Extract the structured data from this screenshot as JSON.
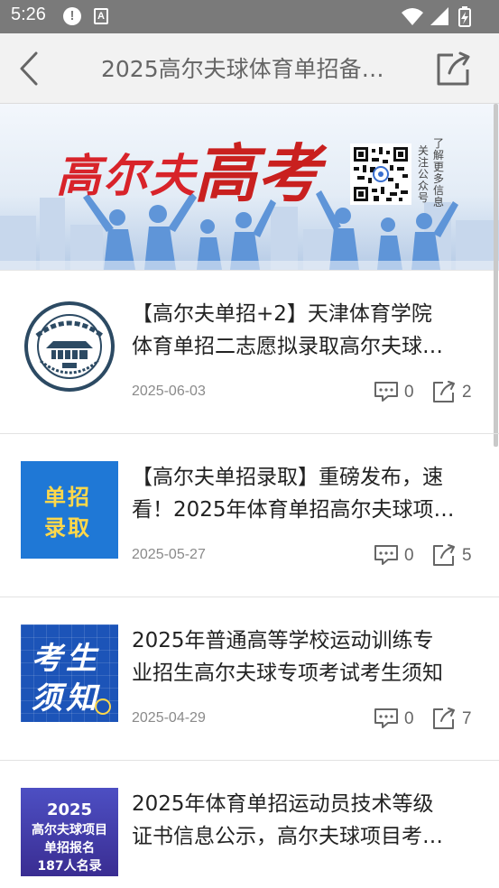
{
  "status_bar": {
    "time": "5:26",
    "alert_glyph": "!",
    "a_glyph": "A",
    "icons": [
      "alert-icon",
      "font-a-icon",
      "wifi-icon",
      "signal-icon",
      "battery-icon"
    ]
  },
  "header": {
    "title": "2025高尔夫球体育单招备…",
    "back_icon": "chevron-left-icon",
    "share_icon": "share-icon"
  },
  "banner": {
    "title_part1": "高尔夫",
    "title_part2": "高考",
    "qr_caption_col1": "关注公众号",
    "qr_caption_col2": "了解更多信息"
  },
  "articles": [
    {
      "title_line1": "【高尔夫单招+2】天津体育学院",
      "title_line2": "体育单招二志愿拟录取高尔夫球…",
      "date": "2025-06-03",
      "comments": "0",
      "shares": "2",
      "thumb": "university-seal"
    },
    {
      "title_line1": "【高尔夫单招录取】重磅发布，速",
      "title_line2": "看！2025年体育单招高尔夫球项…",
      "date": "2025-05-27",
      "comments": "0",
      "shares": "5",
      "thumb": "blue-card",
      "thumb_text1": "单招",
      "thumb_text2": "录取"
    },
    {
      "title_line1": "2025年普通高等学校运动训练专",
      "title_line2": "业招生高尔夫球专项考试考生须知",
      "date": "2025-04-29",
      "comments": "0",
      "shares": "7",
      "thumb": "grid-card",
      "thumb_text1": "考生",
      "thumb_text2": "须知"
    },
    {
      "title_line1": "2025年体育单招运动员技术等级",
      "title_line2": "证书信息公示，高尔夫球项目考…",
      "date": "",
      "comments": "",
      "shares": "",
      "thumb": "purple-card",
      "thumb_text1": "2025",
      "thumb_text2": "高尔夫球项目",
      "thumb_text3": "单招报名",
      "thumb_text4": "187人名录"
    }
  ],
  "colors": {
    "status_bar": "#7a7a7a",
    "header_bg": "#f2f2f2",
    "banner_red": "#d8232a",
    "text_primary": "#222222",
    "text_secondary": "#8a8a8a"
  }
}
